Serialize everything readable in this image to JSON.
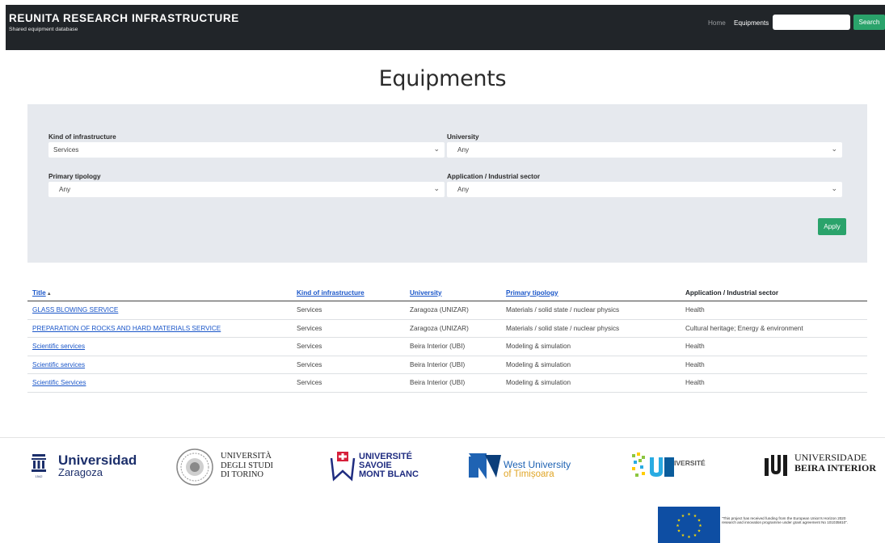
{
  "header": {
    "brand_title": "REUNITA RESEARCH INFRASTRUCTURE",
    "brand_subtitle": "Shared equipment database",
    "nav_home": "Home",
    "nav_equipments": "Equipments",
    "search_placeholder": "",
    "search_button": "Search"
  },
  "page": {
    "title": "Equipments"
  },
  "filters": {
    "kind_label": "Kind of infrastructure",
    "kind_value": "Services",
    "university_label": "University",
    "university_value": "Any",
    "primary_label": "Primary tipology",
    "primary_value": "Any",
    "sector_label": "Application / Industrial sector",
    "sector_value": "Any",
    "apply_button": "Apply"
  },
  "table": {
    "headers": {
      "title": "Title",
      "kind": "Kind of infrastructure",
      "university": "University",
      "primary": "Primary tipology",
      "sector": "Application / Industrial sector"
    },
    "rows": [
      {
        "title": "GLASS BLOWING SERVICE",
        "kind": "Services",
        "university": "Zaragoza (UNIZAR)",
        "primary": "Materials / solid state / nuclear physics",
        "sector": "Health"
      },
      {
        "title": "PREPARATION OF ROCKS AND HARD MATERIALS SERVICE",
        "kind": "Services",
        "university": "Zaragoza (UNIZAR)",
        "primary": "Materials / solid state / nuclear physics",
        "sector": "Cultural heritage; Energy & environment"
      },
      {
        "title": "Scientific services",
        "kind": "Services",
        "university": "Beira Interior (UBI)",
        "primary": "Modeling & simulation",
        "sector": "Health"
      },
      {
        "title": "Scientific services",
        "kind": "Services",
        "university": "Beira Interior (UBI)",
        "primary": "Modeling & simulation",
        "sector": "Health"
      },
      {
        "title": "Scientific Services",
        "kind": "Services",
        "university": "Beira Interior (UBI)",
        "primary": "Modeling & simulation",
        "sector": "Health"
      }
    ]
  },
  "footer": {
    "uz_name": "Universidad",
    "uz_city": "Zaragoza",
    "torino": "UNIVERSITÀ\nDEGLI STUDI\nDI TORINO",
    "savoie": "UNIVERSITÉ\nSAVOIE\nMONT BLANC",
    "wu_line1": "West University",
    "wu_line2": "of Timișoara",
    "ua_name": "IVERSITÉ",
    "ubi_line1": "UNIVERSIDADE",
    "ubi_line2": "BEIRA INTERIOR",
    "eu_text": "\"This project has received funding from the European Union's Horizon 2020 research and innovation programme under grant agreement No 101035810\"."
  },
  "colors": {
    "navbar": "#212529",
    "accent_green": "#2aa36b",
    "link_blue": "#1a56c9",
    "filter_bg": "#e6e9ee"
  }
}
